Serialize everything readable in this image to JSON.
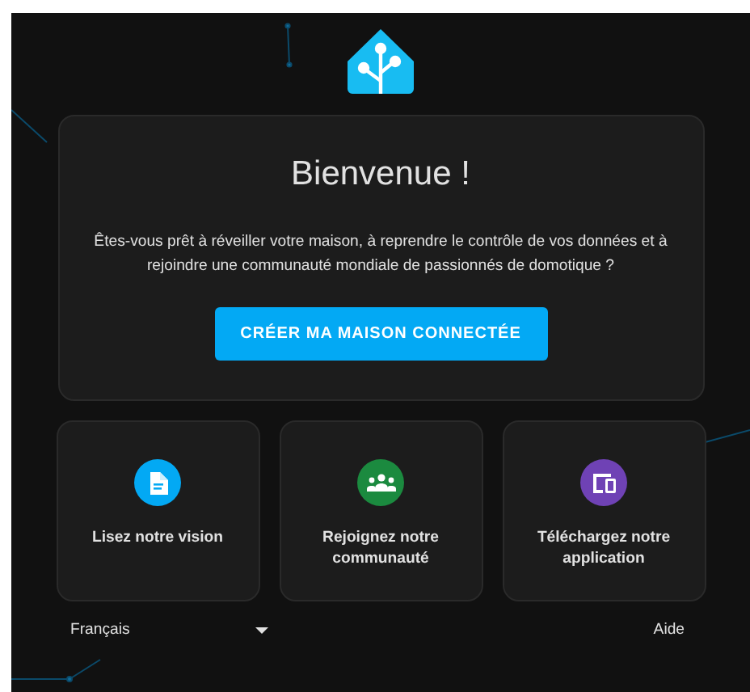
{
  "welcome": {
    "title": "Bienvenue !",
    "text": "Êtes-vous prêt à réveiller votre maison, à reprendre le contrôle de vos données et à rejoindre une communauté mondiale de passionnés de domotique ?",
    "button": "CRÉER MA MAISON CONNECTÉE"
  },
  "tiles": [
    {
      "label": "Lisez notre vision",
      "kind": "document",
      "color": "#03a9f4"
    },
    {
      "label": "Rejoignez notre communauté",
      "kind": "group",
      "color": "#1b8a3f"
    },
    {
      "label": "Téléchargez notre application",
      "kind": "devices",
      "color": "#6f42b5"
    }
  ],
  "footer": {
    "language": "Français",
    "help": "Aide"
  }
}
